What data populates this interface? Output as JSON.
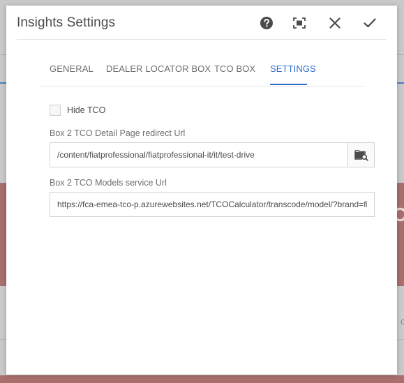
{
  "background": {
    "hero_fragment": "C",
    "strip_fragment": "c"
  },
  "dialog": {
    "title": "Insights Settings",
    "header_buttons": {
      "help": "help-icon",
      "fullscreen": "fullscreen-icon",
      "close": "close-icon",
      "done": "checkmark-icon"
    }
  },
  "tabs": [
    {
      "label": "GENERAL",
      "active": false
    },
    {
      "label": "DEALER LOCATOR BOX",
      "active": false
    },
    {
      "label": "TCO BOX",
      "active": false
    },
    {
      "label": "SETTINGS",
      "active": true
    }
  ],
  "form": {
    "hide_tco": {
      "label": "Hide TCO",
      "checked": false
    },
    "detail_page_url": {
      "label": "Box 2 TCO Detail Page redirect Url",
      "value": "/content/fiatprofessional/fiatprofessional-it/it/test-drive",
      "browse_icon": "folder-search-icon"
    },
    "models_service_url": {
      "label": "Box 2 TCO Models service Url",
      "value": "https://fca-emea-tco-p.azurewebsites.net/TCOCalculator/transcode/model/?brand=fi"
    }
  },
  "colors": {
    "accent": "#326ec8",
    "text": "#4b4b4b",
    "muted": "#6e6e6e",
    "background_hero": "#a96f6f"
  }
}
